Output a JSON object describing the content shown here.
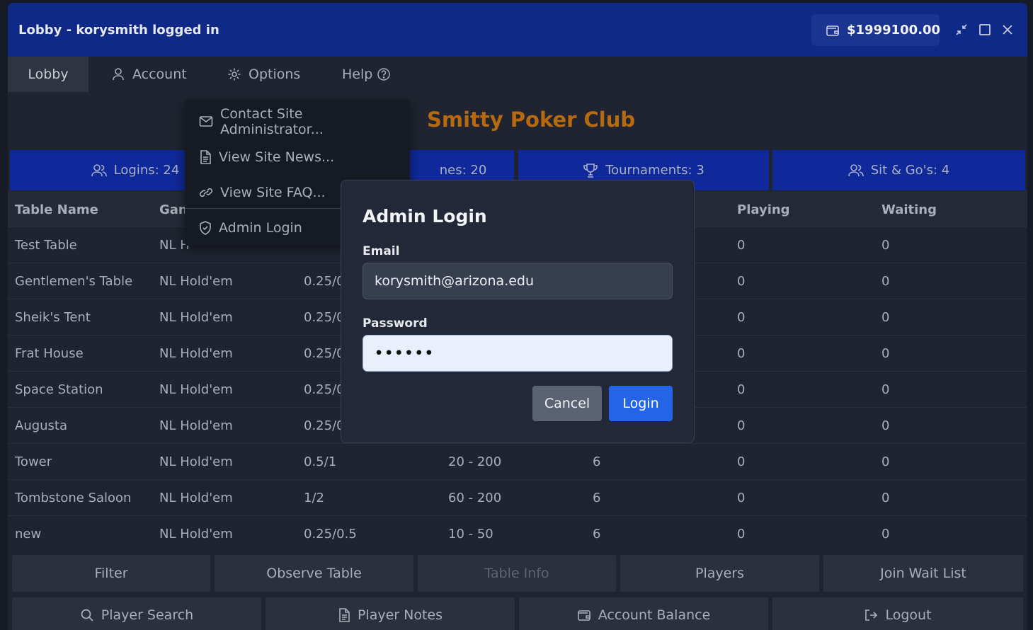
{
  "window": {
    "title": "Lobby - korysmith logged in",
    "balance": "$1999100.00"
  },
  "menu": {
    "items": [
      {
        "label": "Lobby",
        "icon": "none"
      },
      {
        "label": "Account",
        "icon": "user-icon"
      },
      {
        "label": "Options",
        "icon": "gear-icon"
      },
      {
        "label": "Help",
        "icon": "question-circle-icon"
      }
    ]
  },
  "club_name": "Smitty Poker Club",
  "stats": [
    {
      "label": "Logins: 24",
      "icon": "users-icon"
    },
    {
      "label": "nes: 20",
      "icon": "none"
    },
    {
      "label": "Tournaments: 3",
      "icon": "trophy-icon"
    },
    {
      "label": "Sit & Go's: 4",
      "icon": "users-icon"
    }
  ],
  "table": {
    "headers": [
      "Table Name",
      "Gan",
      "",
      "",
      "",
      "Playing",
      "Waiting"
    ],
    "rows": [
      {
        "name": "Test Table",
        "game": "NL H",
        "stakes": "",
        "buyin": "",
        "seats": "",
        "playing": "0",
        "waiting": "0"
      },
      {
        "name": "Gentlemen's Table",
        "game": "NL Hold'em",
        "stakes": "0.25/0",
        "buyin": "",
        "seats": "",
        "playing": "0",
        "waiting": "0"
      },
      {
        "name": "Sheik's Tent",
        "game": "NL Hold'em",
        "stakes": "0.25/0",
        "buyin": "",
        "seats": "",
        "playing": "0",
        "waiting": "0"
      },
      {
        "name": "Frat House",
        "game": "NL Hold'em",
        "stakes": "0.25/0",
        "buyin": "",
        "seats": "",
        "playing": "0",
        "waiting": "0"
      },
      {
        "name": "Space Station",
        "game": "NL Hold'em",
        "stakes": "0.25/0",
        "buyin": "",
        "seats": "",
        "playing": "0",
        "waiting": "0"
      },
      {
        "name": "Augusta",
        "game": "NL Hold'em",
        "stakes": "0.25/0",
        "buyin": "",
        "seats": "",
        "playing": "0",
        "waiting": "0"
      },
      {
        "name": "Tower",
        "game": "NL Hold'em",
        "stakes": "0.5/1",
        "buyin": "20 - 200",
        "seats": "6",
        "playing": "0",
        "waiting": "0"
      },
      {
        "name": "Tombstone Saloon",
        "game": "NL Hold'em",
        "stakes": "1/2",
        "buyin": "60 - 200",
        "seats": "6",
        "playing": "0",
        "waiting": "0"
      },
      {
        "name": "new",
        "game": "NL Hold'em",
        "stakes": "0.25/0.5",
        "buyin": "10 - 50",
        "seats": "6",
        "playing": "0",
        "waiting": "0"
      }
    ]
  },
  "actions_row1": [
    "Filter",
    "Observe Table",
    "Table Info",
    "Players",
    "Join Wait List"
  ],
  "actions_row2": [
    {
      "label": "Player Search",
      "icon": "search-icon"
    },
    {
      "label": "Player Notes",
      "icon": "document-icon"
    },
    {
      "label": "Account Balance",
      "icon": "wallet-icon"
    },
    {
      "label": "Logout",
      "icon": "logout-icon"
    }
  ],
  "help_dropdown": [
    {
      "label": "Contact Site Administrator...",
      "icon": "envelope-icon"
    },
    {
      "label": "View Site News...",
      "icon": "document-icon"
    },
    {
      "label": "View Site FAQ...",
      "icon": "link-icon"
    },
    {
      "label": "Admin Login",
      "icon": "shield-icon"
    }
  ],
  "admin_login": {
    "title": "Admin Login",
    "email_label": "Email",
    "email_value": "korysmith@arizona.edu",
    "password_label": "Password",
    "password_value": "••••••",
    "cancel_label": "Cancel",
    "login_label": "Login"
  },
  "colors": {
    "titlebar": "#0f2a86",
    "stats_bg": "#10299a",
    "club_title": "#b56a10",
    "login_button": "#2464e6"
  }
}
